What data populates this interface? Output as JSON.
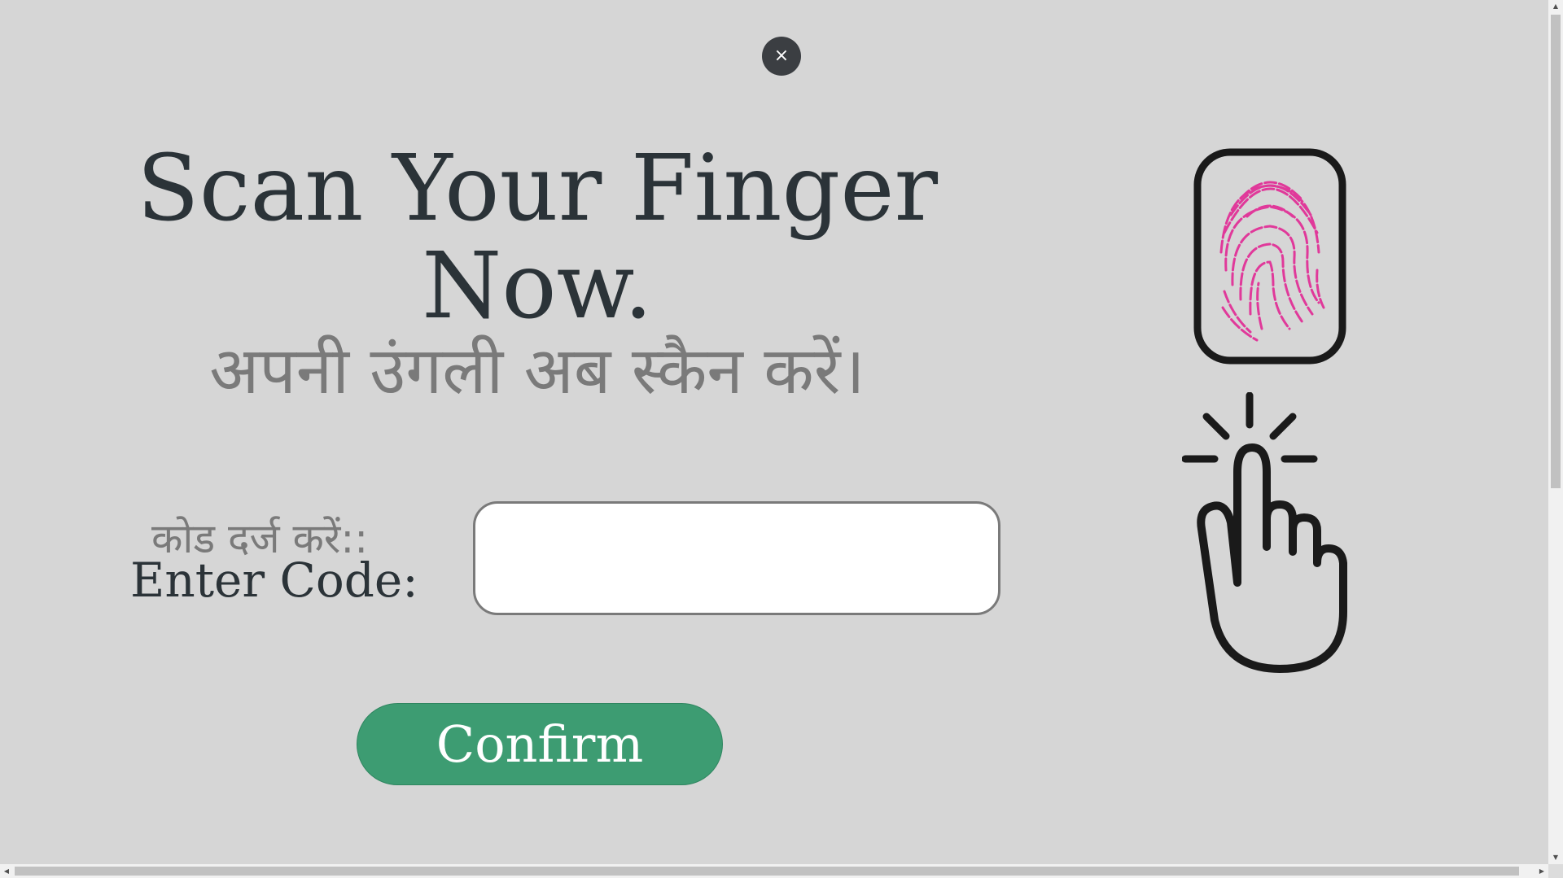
{
  "close": {
    "label": "×"
  },
  "heading": {
    "title_line1": "Scan Your Finger",
    "title_line2": "Now.",
    "subtitle_hindi": "अपनी उंगली अब स्कैन करें।"
  },
  "form": {
    "code_label_hindi": "कोड दर्ज करें::",
    "code_label": "Enter Code:",
    "code_value": "",
    "confirm_label": "Confirm"
  },
  "icons": {
    "fingerprint_device": "fingerprint-scanner-icon",
    "tap_hand": "tap-hand-icon",
    "fingerprint_color": "#e0399a",
    "outline_color": "#1a1a1a"
  },
  "colors": {
    "background": "#d6d6d6",
    "confirm_button": "#3d9c72",
    "close_button": "#3b3e42",
    "title_text": "#2b3338",
    "secondary_text": "#7a7a7a"
  }
}
